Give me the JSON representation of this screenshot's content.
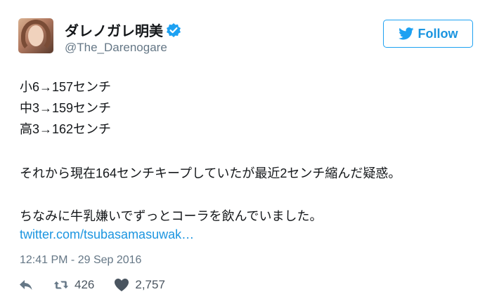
{
  "user": {
    "display_name": "ダレノガレ明美",
    "handle": "@The_Darenogare",
    "verified_icon": "verified-badge-icon"
  },
  "follow_button": {
    "label": "Follow",
    "icon": "twitter-bird-icon"
  },
  "tweet": {
    "lines": [
      "小6→157センチ",
      "中3→159センチ",
      "高3→162センチ",
      "それから現在164センチキープしていたが最近2センチ縮んだ疑惑。",
      "ちなみに牛乳嫌いでずっとコーラを飲んでいました。"
    ],
    "link": "twitter.com/tsubasamasuwak…",
    "timestamp": "12:41 PM - 29 Sep 2016"
  },
  "actions": {
    "reply_icon": "reply-icon",
    "retweet_icon": "retweet-icon",
    "retweet_count": "426",
    "like_icon": "heart-icon",
    "like_count": "2,757"
  },
  "colors": {
    "accent": "#1da1f2",
    "link": "#1b95e0",
    "text": "#14171a",
    "muted": "#657786"
  }
}
